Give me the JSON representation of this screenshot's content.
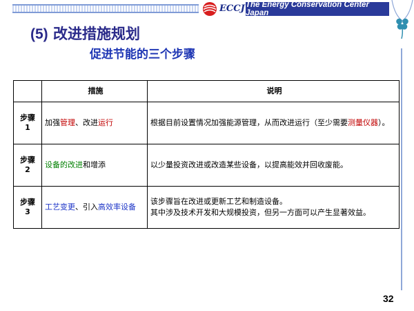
{
  "header": {
    "logo_text": "ECCJ",
    "org_name": "The Energy Conservation Center Japan"
  },
  "title": {
    "number": "(5)",
    "text": "改进措施规划"
  },
  "subtitle": "促进节能的三个步骤",
  "table": {
    "headers": [
      "措施",
      "说明"
    ],
    "rows": [
      {
        "step_label": "步骤",
        "step_num": "1",
        "step_color": "#c00000",
        "measure_parts": [
          {
            "text": "加强",
            "color": "#000000"
          },
          {
            "text": "管理",
            "color": "#c00000"
          },
          {
            "text": "、改进",
            "color": "#000000"
          },
          {
            "text": "运行",
            "color": "#c00000"
          }
        ],
        "desc_parts": [
          {
            "text": "根据目前设置情况加强能源管理，从而改进运行（至少需要",
            "color": "#000000"
          },
          {
            "text": "测量仪器",
            "color": "#c00000"
          },
          {
            "text": "）。",
            "color": "#000000"
          }
        ]
      },
      {
        "step_label": "步骤",
        "step_num": "2",
        "step_color": "#008000",
        "measure_parts": [
          {
            "text": "设备的改进",
            "color": "#008000"
          },
          {
            "text": "和增添",
            "color": "#000000"
          }
        ],
        "desc_parts": [
          {
            "text": "以少量投资改进或改造某些设备，以提高能效并回收废能。",
            "color": "#000000"
          }
        ]
      },
      {
        "step_label": "步骤",
        "step_num": "3",
        "step_color": "#1e36c8",
        "measure_parts": [
          {
            "text": "工艺变更",
            "color": "#1e36c8"
          },
          {
            "text": "、引入",
            "color": "#000000"
          },
          {
            "text": "高效率设备",
            "color": "#1e36c8"
          }
        ],
        "desc_lines": [
          "该步骤旨在改进或更新工艺和制造设备。",
          "其中涉及技术开发和大规模投资，但另一方面可以产生显著效益。"
        ]
      }
    ]
  },
  "page_number": "32",
  "colors": {
    "title": "#2a2a8a",
    "subtitle": "#1e36b4",
    "brand_bg": "#2a3a9a",
    "logo_red": "#d81e1e"
  },
  "icons": [
    "eccj-logo-icon",
    "clover-icon"
  ]
}
